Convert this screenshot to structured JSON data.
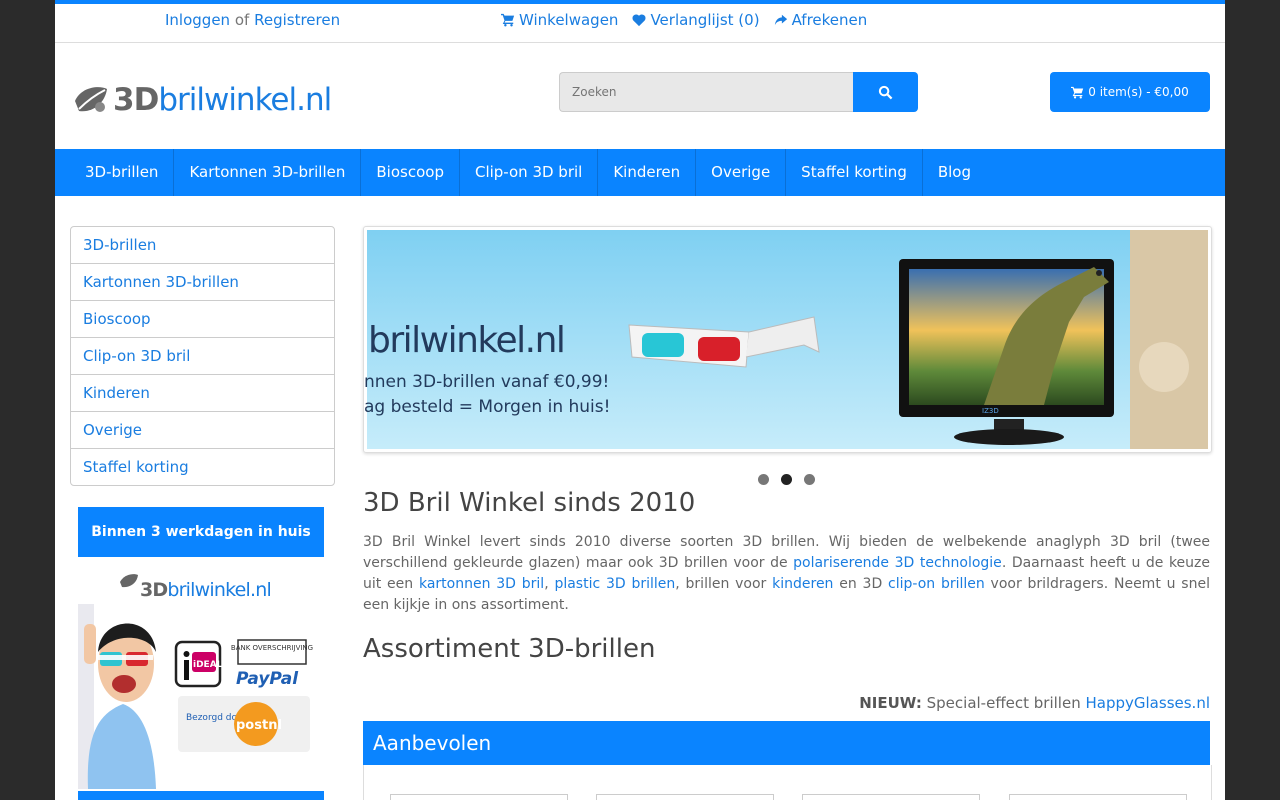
{
  "topbar": {
    "login": "Inloggen",
    "or": "of",
    "register": "Registreren",
    "links": [
      {
        "icon": "cart-icon",
        "label": "Winkelwagen"
      },
      {
        "icon": "heart-icon",
        "label": "Verlanglijst (0)"
      },
      {
        "icon": "share-icon",
        "label": "Afrekenen"
      }
    ]
  },
  "header": {
    "logo_part1": "3D",
    "logo_part2": "brilwinkel.nl",
    "search_placeholder": "Zoeken",
    "cart_label": "0 item(s) - €0,00"
  },
  "nav": [
    "3D-brillen",
    "Kartonnen 3D-brillen",
    "Bioscoop",
    "Clip-on 3D bril",
    "Kinderen",
    "Overige",
    "Staffel korting",
    "Blog"
  ],
  "sidebar": {
    "items": [
      "3D-brillen",
      "Kartonnen 3D-brillen",
      "Bioscoop",
      "Clip-on 3D bril",
      "Kinderen",
      "Overige",
      "Staffel korting"
    ],
    "promo": "Binnen 3 werkdagen in huis",
    "ad": {
      "logo_part1": "3D",
      "logo_part2": "brilwinkel.nl",
      "ideal": "iDEAL",
      "bank": "BANK OVERSCHRIJVING",
      "paypal": "PayPal",
      "bezorgd": "Bezorgd door",
      "postnl": "postnl"
    }
  },
  "banner": {
    "brand": "brilwinkel.nl",
    "line1": "nnen 3D-brillen vanaf €0,99!",
    "line2": "ag besteld = Morgen in huis!",
    "tv_brand": "IZ3D",
    "active_slide": 2,
    "slide_count": 3
  },
  "content": {
    "title": "3D Bril Winkel sinds 2010",
    "intro_1": "3D Bril Winkel levert sinds 2010 diverse soorten 3D brillen. Wij bieden de welbekende anaglyph 3D bril (twee verschillend gekleurde glazen) maar ook 3D brillen voor de ",
    "link_polariserende": "polariserende 3D technologie",
    "intro_2": ". Daarnaast heeft u de keuze uit een ",
    "link_kartonnen": "kartonnen 3D bril",
    "comma": ", ",
    "link_plastic": "plastic 3D brillen",
    "intro_3": ", brillen voor ",
    "link_kinderen": "kinderen",
    "intro_4": " en 3D ",
    "link_clipon": "clip-on brillen",
    "intro_5": " voor brildragers. Neemt u snel een kijkje in ons assortiment.",
    "subtitle": "Assortiment 3D-brillen",
    "nieuw_label": "NIEUW:",
    "nieuw_text": "Special-effect brillen",
    "nieuw_link": "HappyGlasses.nl",
    "section": "Aanbevolen"
  },
  "colors": {
    "accent": "#0a84ff",
    "link": "#1a7de0"
  }
}
